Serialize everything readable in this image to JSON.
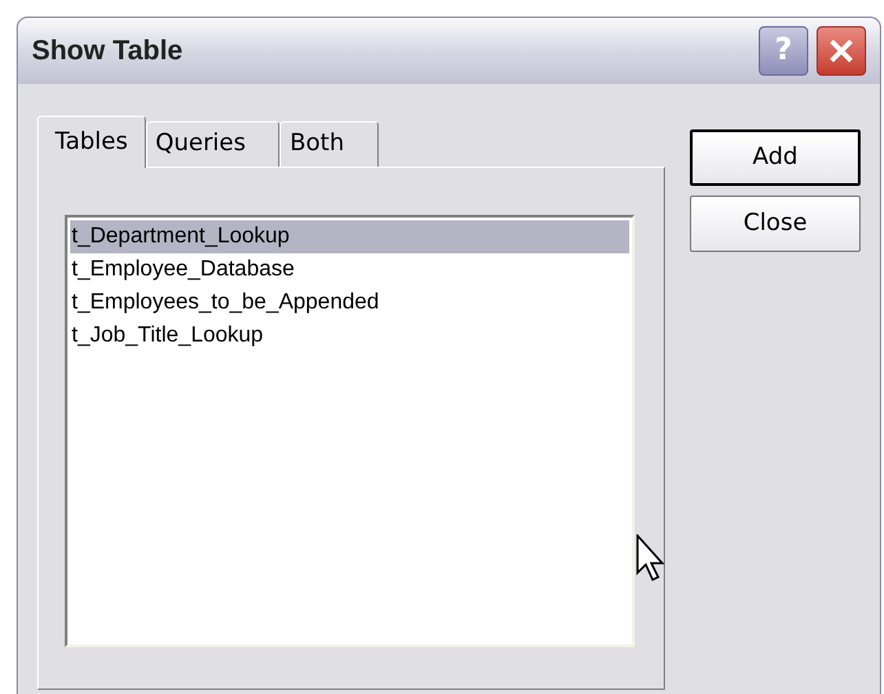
{
  "window": {
    "title": "Show Table"
  },
  "title_buttons": [
    {
      "kind": "help",
      "label": "?"
    },
    {
      "kind": "close"
    }
  ],
  "tabs": [
    {
      "label": "Tables",
      "selected": true
    },
    {
      "label": "Queries",
      "selected": false
    },
    {
      "label": "Both",
      "selected": false
    }
  ],
  "list": [
    {
      "label": "t_Department_Lookup",
      "selected": true
    },
    {
      "label": "t_Employee_Database",
      "selected": false
    },
    {
      "label": "t_Employees_to_be_Appended",
      "selected": false
    },
    {
      "label": "t_Job_Title_Lookup",
      "selected": false
    }
  ],
  "buttons": [
    {
      "label": "Add",
      "default": true
    },
    {
      "label": "Close",
      "default": false
    }
  ]
}
